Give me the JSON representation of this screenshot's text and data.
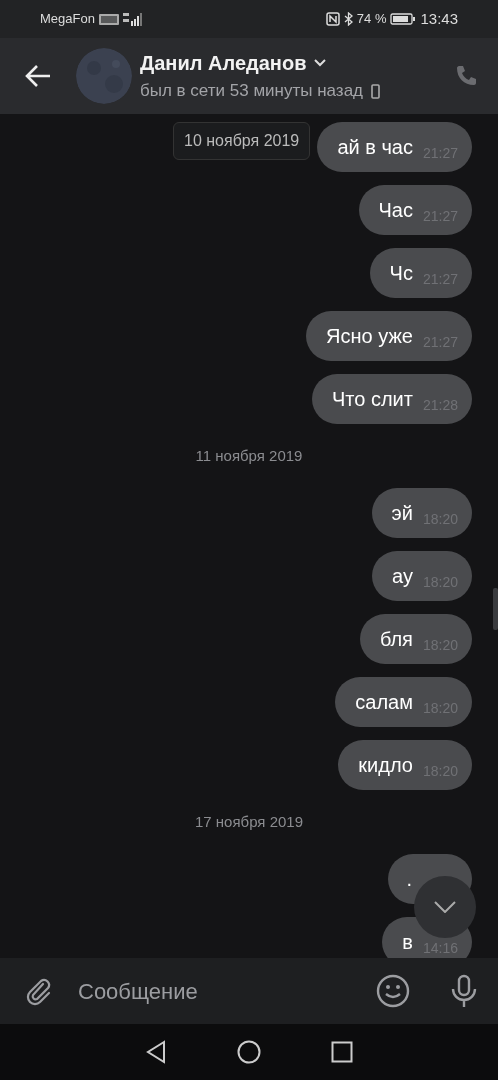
{
  "status_bar": {
    "carrier": "MegaFon",
    "battery": "74 %",
    "time": "13:43"
  },
  "header": {
    "name": "Данил Аледанов",
    "status": "был в сети 53 минуты назад"
  },
  "floating_date": "10 ноября 2019",
  "messages": [
    {
      "kind": "message",
      "text": "ай в час",
      "time": "21:27"
    },
    {
      "kind": "message",
      "text": "Час",
      "time": "21:27"
    },
    {
      "kind": "message",
      "text": "Чс",
      "time": "21:27"
    },
    {
      "kind": "message",
      "text": "Ясно уже",
      "time": "21:27"
    },
    {
      "kind": "message",
      "text": "Что слит",
      "time": "21:28"
    },
    {
      "kind": "date",
      "text": "11 ноября 2019"
    },
    {
      "kind": "message",
      "text": "эй",
      "time": "18:20"
    },
    {
      "kind": "message",
      "text": "ау",
      "time": "18:20"
    },
    {
      "kind": "message",
      "text": "бля",
      "time": "18:20"
    },
    {
      "kind": "message",
      "text": "салам",
      "time": "18:20"
    },
    {
      "kind": "message",
      "text": "кидло",
      "time": "18:20"
    },
    {
      "kind": "date",
      "text": "17 ноября 2019"
    },
    {
      "kind": "message",
      "text": "."
    },
    {
      "kind": "message",
      "text": "в",
      "time": "14:16"
    }
  ],
  "composer": {
    "placeholder": "Сообщение"
  }
}
